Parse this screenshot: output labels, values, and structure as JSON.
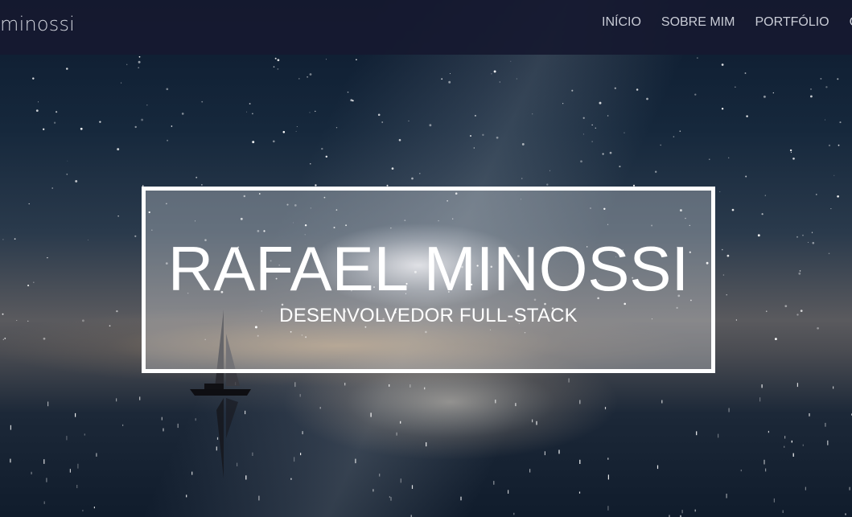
{
  "navbar": {
    "brand": "minossi",
    "links": [
      {
        "label": "INÍCIO"
      },
      {
        "label": "SOBRE MIM"
      },
      {
        "label": "PORTFÓLIO"
      },
      {
        "label": "C"
      }
    ]
  },
  "hero": {
    "title": "RAFAEL MINOSSI",
    "subtitle": "DESENVOLVEDOR FULL-STACK"
  },
  "colors": {
    "navbar_bg": "#161930",
    "nav_text": "#c9ccd6",
    "title_text": "#ffffff"
  }
}
